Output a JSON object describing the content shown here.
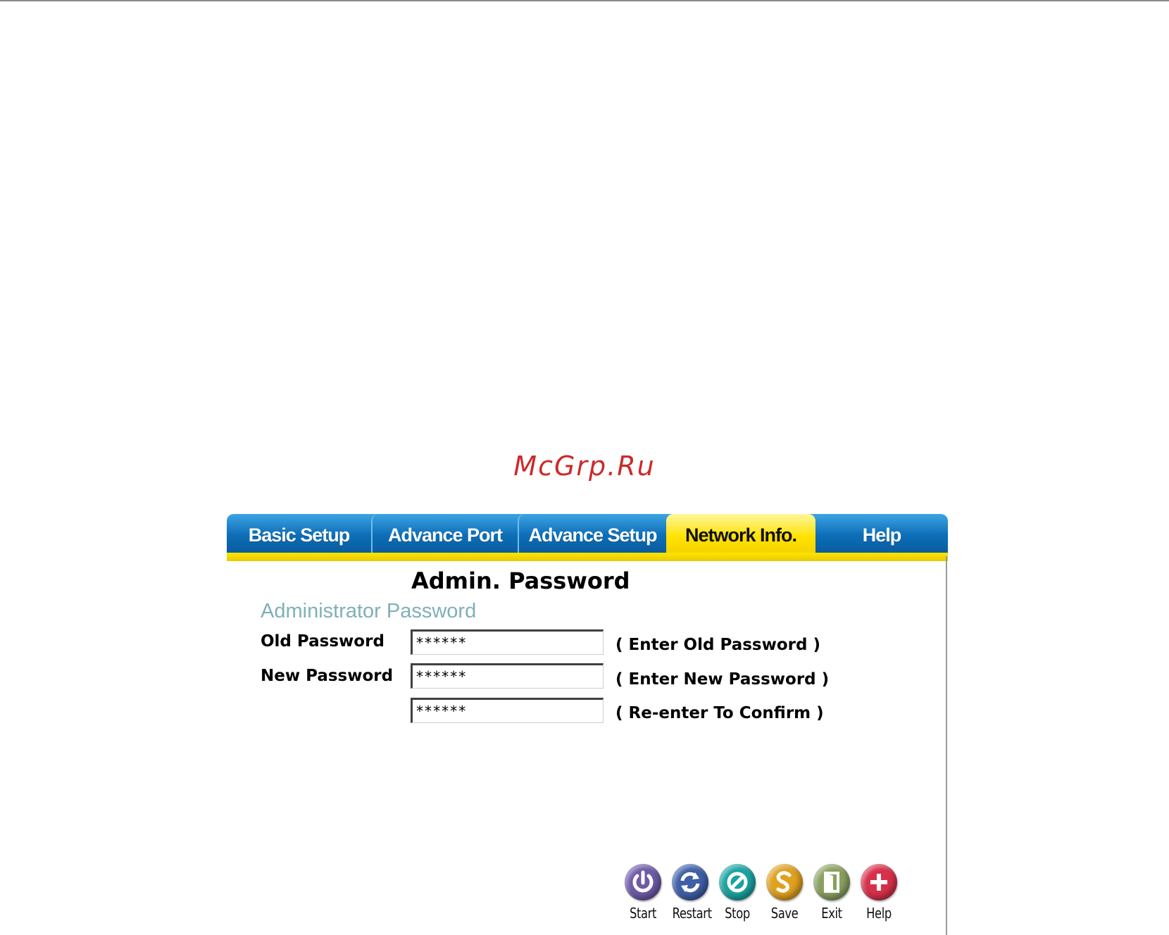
{
  "watermark": "McGrp.Ru",
  "colors": {
    "tab_blue": "#0d6eb8",
    "tab_active_yellow": "#ffe200",
    "section_title": "#7fb0b8"
  },
  "tabs": [
    {
      "label": "Basic Setup",
      "active": false
    },
    {
      "label": "Advance Port",
      "active": false
    },
    {
      "label": "Advance Setup",
      "active": false
    },
    {
      "label": "Network Info.",
      "active": true
    },
    {
      "label": "Help",
      "active": false
    }
  ],
  "page": {
    "heading": "Admin. Password",
    "section_title": "Administrator Password"
  },
  "form": {
    "old_password": {
      "label": "Old Password",
      "value": "******",
      "hint": "( Enter Old Password )"
    },
    "new_password": {
      "label": "New Password",
      "value": "******",
      "hint": "( Enter New Password )"
    },
    "confirm_password": {
      "value": "******",
      "hint": "( Re-enter To Confirm )"
    }
  },
  "controls": [
    {
      "label": "Start",
      "icon": "power-icon",
      "color": "#6e5aa8"
    },
    {
      "label": "Restart",
      "icon": "restart-icon",
      "color": "#3f5fa8"
    },
    {
      "label": "Stop",
      "icon": "stop-icon",
      "color": "#1aa3a0"
    },
    {
      "label": "Save",
      "icon": "save-icon",
      "color": "#e0a020"
    },
    {
      "label": "Exit",
      "icon": "exit-icon",
      "color": "#8aa060"
    },
    {
      "label": "Help",
      "icon": "plus-icon",
      "color": "#d8304a"
    }
  ]
}
